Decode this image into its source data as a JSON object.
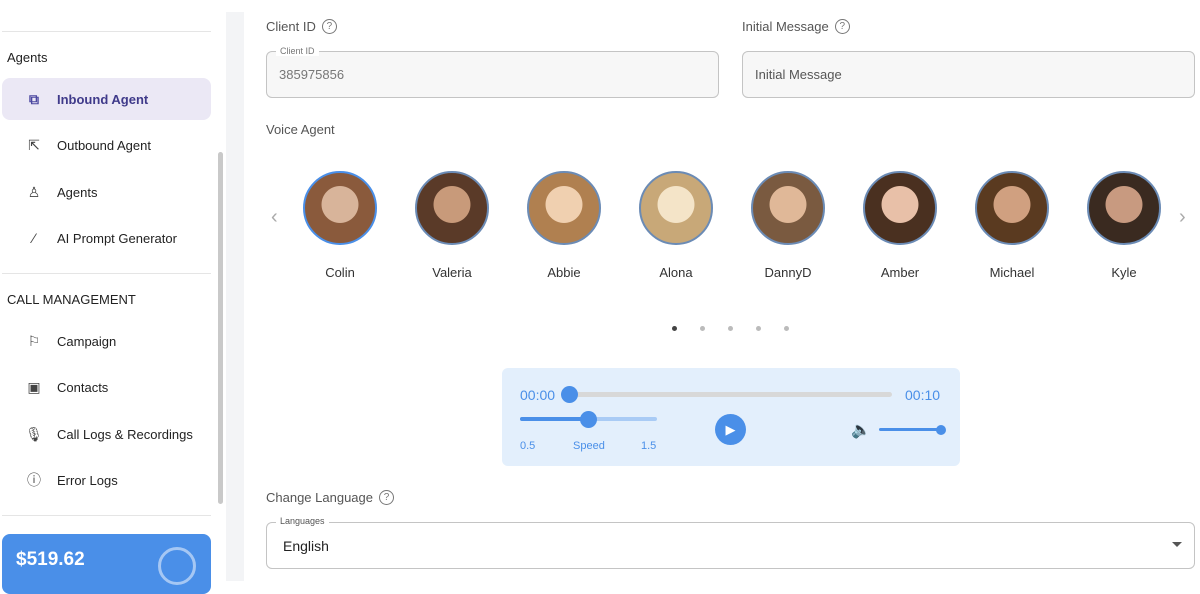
{
  "sidebar": {
    "section_agents": "Agents",
    "items_agents": [
      {
        "label": "Inbound Agent",
        "icon": "inbound-icon",
        "active": true
      },
      {
        "label": "Outbound Agent",
        "icon": "outbound-icon"
      },
      {
        "label": "Agents",
        "icon": "user-icon"
      },
      {
        "label": "AI Prompt Generator",
        "icon": "magic-wand-icon"
      }
    ],
    "section_call": "CALL MANAGEMENT",
    "items_call": [
      {
        "label": "Campaign",
        "icon": "flag-icon"
      },
      {
        "label": "Contacts",
        "icon": "contacts-icon"
      },
      {
        "label": "Call Logs & Recordings",
        "icon": "microphone-icon"
      },
      {
        "label": "Error Logs",
        "icon": "error-icon"
      }
    ],
    "balance": "$519.62"
  },
  "form": {
    "client_id_label": "Client ID",
    "client_id_legend": "Client ID",
    "client_id_value": "385975856",
    "initial_message_label": "Initial Message",
    "initial_message_placeholder": "Initial Message",
    "voice_agent_label": "Voice Agent",
    "agents": [
      "Colin",
      "Valeria",
      "Abbie",
      "Alona",
      "DannyD",
      "Amber",
      "Michael",
      "Kyle"
    ],
    "change_language_label": "Change Language",
    "languages_legend": "Languages",
    "language_value": "English"
  },
  "player": {
    "current": "00:00",
    "duration": "00:10",
    "progress": 0,
    "speed_min": "0.5",
    "speed_label": "Speed",
    "speed_max": "1.5",
    "speed_value": 1.0,
    "volume": 1.0
  },
  "carousel": {
    "pages": 5,
    "current": 1
  }
}
